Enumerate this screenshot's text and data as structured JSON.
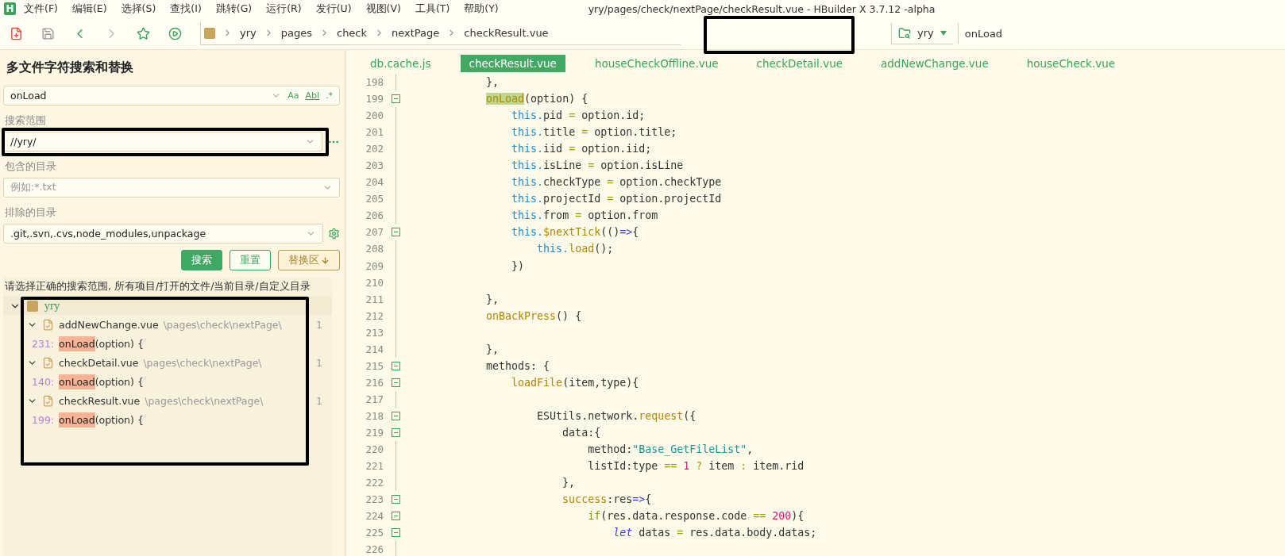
{
  "app_logo": "H",
  "menu": [
    "文件(F)",
    "编辑(E)",
    "选择(S)",
    "查找(I)",
    "跳转(G)",
    "运行(R)",
    "发行(U)",
    "视图(V)",
    "工具(T)",
    "帮助(Y)"
  ],
  "window_title": "yry/pages/check/nextPage/checkResult.vue - HBuilder X 3.7.12 -alpha",
  "toolbar": {
    "breadcrumb": [
      "yry",
      "pages",
      "check",
      "nextPage",
      "checkResult.vue"
    ],
    "project_selector": {
      "value": "yry"
    },
    "search": {
      "value": "onLoad"
    }
  },
  "search_panel": {
    "title": "多文件字符搜索和替换",
    "query": {
      "value": "onLoad"
    },
    "options": [
      "Aa",
      "Abl",
      ".*"
    ],
    "scope_label": "搜索范围",
    "scope": {
      "value": "//yry/"
    },
    "include_label": "包含的目录",
    "include": {
      "placeholder": "例如:*.txt"
    },
    "exclude_label": "排除的目录",
    "exclude": {
      "value": ".git,.svn,.cvs,node_modules,unpackage"
    },
    "buttons": [
      {
        "label": "搜索",
        "kind": "primary"
      },
      {
        "label": "重置",
        "kind": "outline"
      },
      {
        "label": "替换区",
        "kind": "toggle"
      }
    ],
    "hint": "请选择正确的搜索范围, 所有项目/打开的文件/当前目录/自定义目录",
    "results": [
      {
        "name": "yry",
        "expanded": true,
        "children": [
          {
            "file": "addNewChange.vue",
            "path": "\\pages\\check\\nextPage\\",
            "count": "1",
            "expanded": true,
            "children": [
              {
                "line": "231:",
                "match": "onLoad",
                "rest": "(option) {"
              }
            ]
          },
          {
            "file": "checkDetail.vue",
            "path": "\\pages\\check\\nextPage\\",
            "count": "1",
            "expanded": true,
            "children": [
              {
                "line": "140:",
                "match": "onLoad",
                "rest": "(option) {"
              }
            ]
          },
          {
            "file": "checkResult.vue",
            "path": "\\pages\\check\\nextPage\\",
            "count": "1",
            "expanded": true,
            "children": [
              {
                "line": "199:",
                "match": "onLoad",
                "rest": "(option) {"
              }
            ]
          }
        ]
      }
    ]
  },
  "editor": {
    "tabs": [
      {
        "label": "db.cache.js",
        "selected": false
      },
      {
        "label": "checkResult.vue",
        "selected": true
      },
      {
        "label": "houseCheckOffline.vue",
        "selected": false
      },
      {
        "label": "checkDetail.vue",
        "selected": false
      },
      {
        "label": "addNewChange.vue",
        "selected": false
      },
      {
        "label": "houseCheck.vue",
        "selected": false
      }
    ],
    "lines": [
      {
        "number": "198",
        "fold": false,
        "tokens": [
          {
            "text": "        },",
            "kind": "plain"
          }
        ]
      },
      {
        "number": "199",
        "fold": true,
        "tokens": [
          {
            "text": "        onLoad",
            "kind": "match"
          },
          {
            "text": "(option) {",
            "kind": "plain"
          }
        ]
      },
      {
        "number": "200",
        "fold": false,
        "tokens": [
          {
            "text": "            this.",
            "kind": "keyword"
          },
          {
            "text": "pid ",
            "kind": "plain"
          },
          {
            "text": "=",
            "kind": "operator"
          },
          {
            "text": " option.id;",
            "kind": "plain"
          }
        ]
      },
      {
        "number": "201",
        "fold": false,
        "tokens": [
          {
            "text": "            this.",
            "kind": "keyword"
          },
          {
            "text": "title ",
            "kind": "plain"
          },
          {
            "text": "=",
            "kind": "operator"
          },
          {
            "text": " option.title;",
            "kind": "plain"
          }
        ]
      },
      {
        "number": "202",
        "fold": false,
        "tokens": [
          {
            "text": "            this.",
            "kind": "keyword"
          },
          {
            "text": "iid ",
            "kind": "plain"
          },
          {
            "text": "=",
            "kind": "operator"
          },
          {
            "text": " option.iid;",
            "kind": "plain"
          }
        ]
      },
      {
        "number": "203",
        "fold": false,
        "tokens": [
          {
            "text": "            this.",
            "kind": "keyword"
          },
          {
            "text": "isLine ",
            "kind": "plain"
          },
          {
            "text": "=",
            "kind": "operator"
          },
          {
            "text": " option.isLine",
            "kind": "plain"
          }
        ]
      },
      {
        "number": "204",
        "fold": false,
        "tokens": [
          {
            "text": "            this.",
            "kind": "keyword"
          },
          {
            "text": "checkType ",
            "kind": "plain"
          },
          {
            "text": "=",
            "kind": "operator"
          },
          {
            "text": " option.checkType",
            "kind": "plain"
          }
        ]
      },
      {
        "number": "205",
        "fold": false,
        "tokens": [
          {
            "text": "            this.",
            "kind": "keyword"
          },
          {
            "text": "projectId ",
            "kind": "plain"
          },
          {
            "text": "=",
            "kind": "operator"
          },
          {
            "text": " option.projectId",
            "kind": "plain"
          }
        ]
      },
      {
        "number": "206",
        "fold": false,
        "tokens": [
          {
            "text": "            this.",
            "kind": "keyword"
          },
          {
            "text": "from ",
            "kind": "plain"
          },
          {
            "text": "=",
            "kind": "operator"
          },
          {
            "text": " option.from",
            "kind": "plain"
          }
        ]
      },
      {
        "number": "207",
        "fold": true,
        "tokens": [
          {
            "text": "            this.",
            "kind": "keyword"
          },
          {
            "text": "$nextTick",
            "kind": "function"
          },
          {
            "text": "(()",
            "kind": "plain"
          },
          {
            "text": "=>",
            "kind": "arrow"
          },
          {
            "text": "{",
            "kind": "plain"
          }
        ]
      },
      {
        "number": "208",
        "fold": false,
        "tokens": [
          {
            "text": "                this.",
            "kind": "keyword"
          },
          {
            "text": "load",
            "kind": "function"
          },
          {
            "text": "();",
            "kind": "plain"
          }
        ]
      },
      {
        "number": "209",
        "fold": false,
        "tokens": [
          {
            "text": "            })",
            "kind": "plain"
          }
        ]
      },
      {
        "number": "210",
        "fold": false
      },
      {
        "number": "211",
        "fold": false,
        "tokens": [
          {
            "text": "        },",
            "kind": "plain"
          }
        ]
      },
      {
        "number": "212",
        "fold": false,
        "tokens": [
          {
            "text": "        onBackPress",
            "kind": "function"
          },
          {
            "text": "() {",
            "kind": "plain"
          }
        ]
      },
      {
        "number": "213",
        "fold": false
      },
      {
        "number": "214",
        "fold": false,
        "tokens": [
          {
            "text": "        },",
            "kind": "plain"
          }
        ]
      },
      {
        "number": "215",
        "fold": true,
        "tokens": [
          {
            "text": "        methods: {",
            "kind": "plain"
          }
        ]
      },
      {
        "number": "216",
        "fold": true,
        "tokens": [
          {
            "text": "            loadFile",
            "kind": "function"
          },
          {
            "text": "(item,type){",
            "kind": "plain"
          }
        ]
      },
      {
        "number": "217",
        "fold": false
      },
      {
        "number": "218",
        "fold": true,
        "tokens": [
          {
            "text": "                ESUtils.network.",
            "kind": "plain"
          },
          {
            "text": "request",
            "kind": "function"
          },
          {
            "text": "({",
            "kind": "plain"
          }
        ]
      },
      {
        "number": "219",
        "fold": true,
        "tokens": [
          {
            "text": "                    data:{",
            "kind": "plain"
          }
        ]
      },
      {
        "number": "220",
        "fold": false,
        "tokens": [
          {
            "text": "                        method:",
            "kind": "plain"
          },
          {
            "text": "\"Base_GetFileList\"",
            "kind": "string"
          },
          {
            "text": ",",
            "kind": "plain"
          }
        ]
      },
      {
        "number": "221",
        "fold": false,
        "tokens": [
          {
            "text": "                        listId:type ",
            "kind": "plain"
          },
          {
            "text": "== ",
            "kind": "operator"
          },
          {
            "text": "1 ",
            "kind": "number"
          },
          {
            "text": "? ",
            "kind": "operator"
          },
          {
            "text": "item ",
            "kind": "plain"
          },
          {
            "text": ": ",
            "kind": "operator"
          },
          {
            "text": "item.rid",
            "kind": "plain"
          }
        ]
      },
      {
        "number": "222",
        "fold": false,
        "tokens": [
          {
            "text": "                    },",
            "kind": "plain"
          }
        ]
      },
      {
        "number": "223",
        "fold": true,
        "tokens": [
          {
            "text": "                    success",
            "kind": "function"
          },
          {
            "text": ":res",
            "kind": "plain"
          },
          {
            "text": "=>",
            "kind": "arrow"
          },
          {
            "text": "{",
            "kind": "plain"
          }
        ]
      },
      {
        "number": "224",
        "fold": true,
        "tokens": [
          {
            "text": "                        if",
            "kind": "control"
          },
          {
            "text": "(res.data.response.code ",
            "kind": "plain"
          },
          {
            "text": "== ",
            "kind": "operator"
          },
          {
            "text": "200",
            "kind": "number"
          },
          {
            "text": "){",
            "kind": "plain"
          }
        ]
      },
      {
        "number": "225",
        "fold": true,
        "tokens": [
          {
            "text": "                            let ",
            "kind": "let"
          },
          {
            "text": "datas ",
            "kind": "plain"
          },
          {
            "text": "= ",
            "kind": "operator"
          },
          {
            "text": "res.data.body.datas;",
            "kind": "plain"
          }
        ]
      },
      {
        "number": "226",
        "fold": false
      }
    ]
  }
}
